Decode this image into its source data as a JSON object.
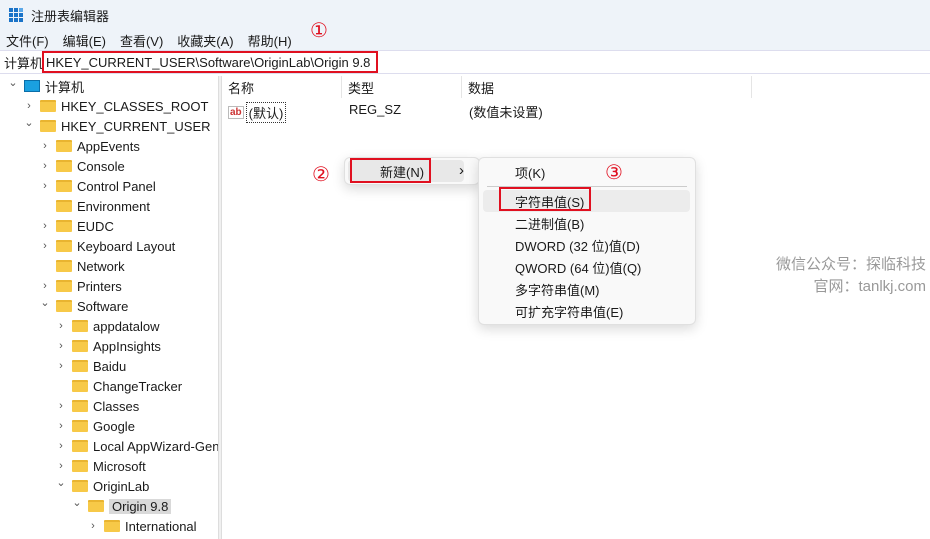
{
  "window": {
    "title": "注册表编辑器"
  },
  "menu": [
    "文件(F)",
    "编辑(E)",
    "查看(V)",
    "收藏夹(A)",
    "帮助(H)"
  ],
  "address": {
    "label": "计算机",
    "path": "HKEY_CURRENT_USER\\Software\\OriginLab\\Origin 9.8"
  },
  "annotations": [
    "①",
    "②",
    "③"
  ],
  "tree": [
    {
      "label": "计算机",
      "level": 0,
      "state": "expanded",
      "icon": "computer-icon"
    },
    {
      "label": "HKEY_CLASSES_ROOT",
      "level": 1,
      "state": "collapsed"
    },
    {
      "label": "HKEY_CURRENT_USER",
      "level": 1,
      "state": "expanded"
    },
    {
      "label": "AppEvents",
      "level": 2,
      "state": "collapsed"
    },
    {
      "label": "Console",
      "level": 2,
      "state": "collapsed"
    },
    {
      "label": "Control Panel",
      "level": 2,
      "state": "collapsed"
    },
    {
      "label": "Environment",
      "level": 2,
      "state": "leaf"
    },
    {
      "label": "EUDC",
      "level": 2,
      "state": "collapsed"
    },
    {
      "label": "Keyboard Layout",
      "level": 2,
      "state": "collapsed"
    },
    {
      "label": "Network",
      "level": 2,
      "state": "leaf"
    },
    {
      "label": "Printers",
      "level": 2,
      "state": "collapsed"
    },
    {
      "label": "Software",
      "level": 2,
      "state": "expanded"
    },
    {
      "label": "appdatalow",
      "level": 3,
      "state": "collapsed"
    },
    {
      "label": "AppInsights",
      "level": 3,
      "state": "collapsed"
    },
    {
      "label": "Baidu",
      "level": 3,
      "state": "collapsed"
    },
    {
      "label": "ChangeTracker",
      "level": 3,
      "state": "leaf"
    },
    {
      "label": "Classes",
      "level": 3,
      "state": "collapsed"
    },
    {
      "label": "Google",
      "level": 3,
      "state": "collapsed"
    },
    {
      "label": "Local AppWizard-Generated Applications",
      "level": 3,
      "state": "collapsed"
    },
    {
      "label": "Microsoft",
      "level": 3,
      "state": "collapsed"
    },
    {
      "label": "OriginLab",
      "level": 3,
      "state": "expanded"
    },
    {
      "label": "Origin 9.8",
      "level": 4,
      "state": "expanded",
      "selected": true
    },
    {
      "label": "International",
      "level": 5,
      "state": "collapsed"
    }
  ],
  "columns": [
    "名称",
    "类型",
    "数据"
  ],
  "values": [
    {
      "name": "(默认)",
      "type": "REG_SZ",
      "data": "(数值未设置)"
    }
  ],
  "context_menu": {
    "new_label": "新建(N)",
    "arrow": "›"
  },
  "submenu": [
    "项(K)",
    "字符串值(S)",
    "二进制值(B)",
    "DWORD (32 位)值(D)",
    "QWORD (64 位)值(Q)",
    "多字符串值(M)",
    "可扩充字符串值(E)"
  ],
  "watermark": [
    "微信公众号：探临科技",
    "官网：tanlkj.com"
  ]
}
